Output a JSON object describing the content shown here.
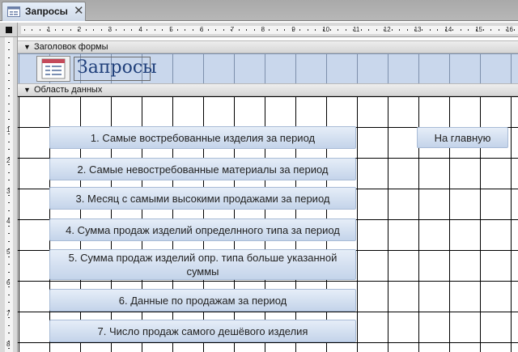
{
  "tab": {
    "title": "Запросы",
    "close": "✕"
  },
  "ruler": {
    "h_marks": [
      "1",
      "2",
      "3",
      "4",
      "5",
      "6",
      "7",
      "8",
      "9",
      "10",
      "11",
      "12",
      "13",
      "14",
      "15",
      "16"
    ],
    "v_marks": [
      "1",
      "2",
      "3",
      "4",
      "5",
      "6",
      "7",
      "8"
    ]
  },
  "sections": {
    "header": "Заголовок формы",
    "detail": "Область данных"
  },
  "form": {
    "title": "Запросы"
  },
  "buttons": [
    "1. Самые востребованные изделия за период",
    "2. Самые невостребованные материалы за период",
    "3. Месяц с самыми высокими продажами за период",
    "4. Сумма продаж изделий определнного типа за период",
    "5. Сумма продаж изделий опр. типа больше указанной суммы",
    "6. Данные по продажам за период",
    "7. Число продаж самого дешёвого изделия"
  ],
  "home_button": "На главную"
}
